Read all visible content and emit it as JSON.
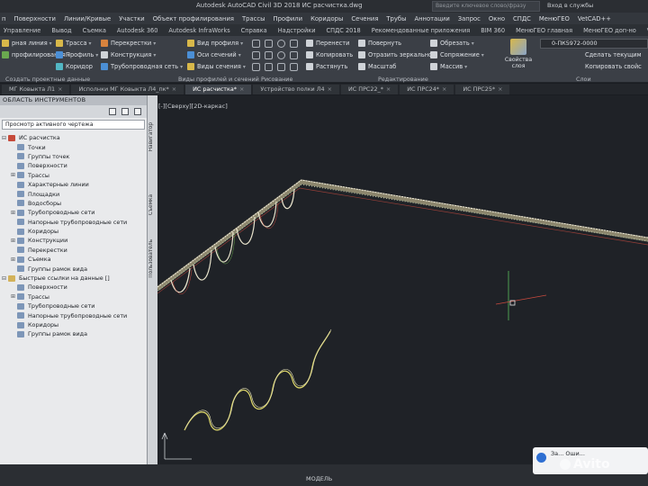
{
  "titlebar": {
    "title": "Autodesk AutoCAD Civil 3D 2018    ИС расчистка.dwg",
    "search_placeholder": "Введите ключевое слово/фразу",
    "login": "Вход в службы"
  },
  "menubar": {
    "items": [
      "п",
      "Поверхности",
      "Линии/Кривые",
      "Участки",
      "Объект профилирования",
      "Трассы",
      "Профили",
      "Коридоры",
      "Сечения",
      "Трубы",
      "Аннотации",
      "Запрос",
      "Окно",
      "СПДС",
      "МенюГЕО",
      "VetCAD++"
    ]
  },
  "ribbon_tabs": {
    "items": [
      "Управление",
      "Вывод",
      "Съемка",
      "Autodesk 360",
      "Autodesk InfraWorks",
      "Справка",
      "Надстройки",
      "СПДС 2018",
      "Рекомендованные приложения",
      "BIM 360",
      "МенюГЕО главная",
      "МенюГЕО доп-но",
      "VetCAD++"
    ]
  },
  "ribbon": {
    "col1": [
      "рная линия",
      "профилирования"
    ],
    "col2": [
      "Трасса",
      "Профиль",
      "Коридор"
    ],
    "col3": [
      "Перекрестки",
      "Конструкция",
      "Трубопроводная сеть"
    ],
    "col4": [
      "Вид профиля",
      "Оси сечений",
      "Виды сечения"
    ],
    "col5": [
      "Перенести",
      "Копировать",
      "Растянуть"
    ],
    "col6": [
      "Повернуть",
      "Отразить зеркально",
      "Масштаб"
    ],
    "col7": [
      "Обрезать",
      "Сопряжение",
      "Массив"
    ],
    "layers_button": "Свойства слоя",
    "layer_combo": "0-ПК5972-0000",
    "right_col": [
      "Сделать текущим",
      "Копировать свойс"
    ],
    "panel_titles": {
      "create": "Создать проектные данные",
      "views": "Виды профилей и сечений",
      "draw": "Рисование",
      "edit": "Редактирование",
      "layers": "Слои"
    }
  },
  "doc_tabs": [
    {
      "label": "МГ Ковыкта Л1",
      "active": false
    },
    {
      "label": "Исполнки МГ Ковыкта Л4_пк*",
      "active": false
    },
    {
      "label": "ИС расчистка*",
      "active": true
    },
    {
      "label": "Устройство полки Л4",
      "active": false
    },
    {
      "label": "ИС ПРС22_*",
      "active": false
    },
    {
      "label": "ИС ПРС24*",
      "active": false
    },
    {
      "label": "ИС ПРС25*",
      "active": false
    }
  ],
  "toolspace": {
    "header": "ОБЛАСТЬ ИНСТРУМЕНТОВ",
    "combo": "Просмотр активного чертежа",
    "tree": [
      {
        "label": "ИС расчистка",
        "level": 0,
        "exp": "⊟",
        "icon": "rt"
      },
      {
        "label": "Точки",
        "level": 1,
        "exp": "",
        "icon": ""
      },
      {
        "label": "Группы точек",
        "level": 1,
        "exp": "",
        "icon": ""
      },
      {
        "label": "Поверхности",
        "level": 1,
        "exp": "",
        "icon": ""
      },
      {
        "label": "Трассы",
        "level": 1,
        "exp": "⊞",
        "icon": ""
      },
      {
        "label": "Характерные линии",
        "level": 1,
        "exp": "",
        "icon": ""
      },
      {
        "label": "Площадки",
        "level": 1,
        "exp": "",
        "icon": ""
      },
      {
        "label": "Водосборы",
        "level": 1,
        "exp": "",
        "icon": ""
      },
      {
        "label": "Трубопроводные сети",
        "level": 1,
        "exp": "⊞",
        "icon": ""
      },
      {
        "label": "Напорные трубопроводные сети",
        "level": 1,
        "exp": "",
        "icon": ""
      },
      {
        "label": "Коридоры",
        "level": 1,
        "exp": "",
        "icon": ""
      },
      {
        "label": "Конструкции",
        "level": 1,
        "exp": "⊞",
        "icon": ""
      },
      {
        "label": "Перекрестки",
        "level": 1,
        "exp": "",
        "icon": ""
      },
      {
        "label": "Съемка",
        "level": 1,
        "exp": "⊞",
        "icon": ""
      },
      {
        "label": "Группы рамок вида",
        "level": 1,
        "exp": "",
        "icon": ""
      },
      {
        "label": "Быстрые ссылки на данные []",
        "level": 0,
        "exp": "⊟",
        "icon": "fld"
      },
      {
        "label": "Поверхности",
        "level": 1,
        "exp": "",
        "icon": ""
      },
      {
        "label": "Трассы",
        "level": 1,
        "exp": "⊞",
        "icon": ""
      },
      {
        "label": "Трубопроводные сети",
        "level": 1,
        "exp": "",
        "icon": ""
      },
      {
        "label": "Напорные трубопроводные сети",
        "level": 1,
        "exp": "",
        "icon": ""
      },
      {
        "label": "Коридоры",
        "level": 1,
        "exp": "",
        "icon": ""
      },
      {
        "label": "Группы рамок вида",
        "level": 1,
        "exp": "",
        "icon": ""
      }
    ],
    "side_tabs": [
      "Навигатор",
      "Съемка",
      "Пользователь"
    ]
  },
  "canvas": {
    "view_label": "[-][Сверху][2D-каркас]"
  },
  "status": {
    "model": "МОДЕЛЬ",
    "notification": "За... Оши..."
  },
  "watermark": "Avito"
}
